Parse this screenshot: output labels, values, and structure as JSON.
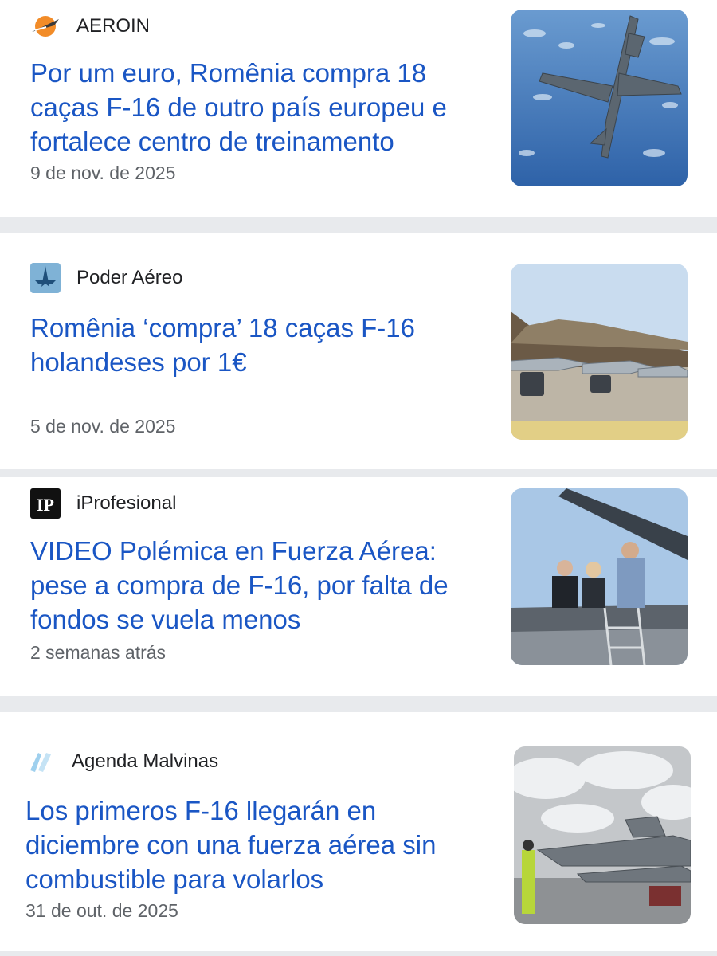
{
  "articles": [
    {
      "source": "AEROIN",
      "source_icon": "aeroin-logo-icon",
      "title": "Por um euro, Romênia compra 18 caças F-16 de outro país europeu e fortalece centro de treinamento",
      "date": "9 de nov. de 2025",
      "thumbnail": "f16-over-sea-image"
    },
    {
      "source": "Poder Aéreo",
      "source_icon": "poder-aereo-logo-icon",
      "title": "Romênia ‘compra’ 18 caças F-16 holandeses por 1€",
      "date": "5 de nov. de 2025",
      "thumbnail": "f16-hangar-row-image"
    },
    {
      "source": "iProfesional",
      "source_icon": "iprofesional-logo-icon",
      "title": "VIDEO Polémica en Fuerza Aérea: pese a compra de F-16, por falta de fondos se vuela menos",
      "date": "2 semanas atrás",
      "thumbnail": "people-near-f16-image"
    },
    {
      "source": "Agenda Malvinas",
      "source_icon": "agenda-malvinas-logo-icon",
      "title": "Los primeros F-16 llegarán en diciembre con una fuerza aérea sin combustible para volarlos",
      "date": "31 de out. de 2025",
      "thumbnail": "f16-cloudy-tarmac-image"
    }
  ],
  "colors": {
    "title": "#1a56c4",
    "date": "#5f6368",
    "divider": "#e8eaed"
  }
}
